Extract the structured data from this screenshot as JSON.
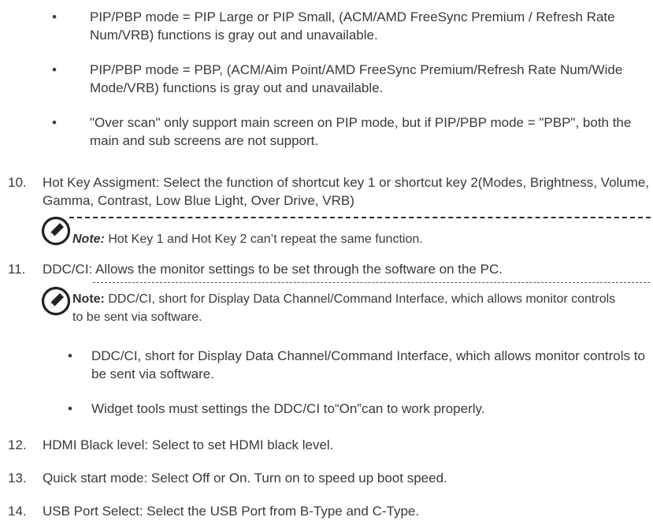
{
  "bullets_top": [
    "PIP/PBP mode = PIP Large or PIP Small, (ACM/AMD FreeSync Premium / Refresh Rate Num/VRB) functions is gray out and unavailable.",
    "PIP/PBP mode = PBP, (ACM/Aim Point/AMD FreeSync Premium/Refresh Rate Num/Wide Mode/VRB) functions is gray out and unavailable.",
    "\"Over scan\" only support main screen on PIP mode, but if PIP/PBP mode = \"PBP\", both the main and sub screens are not support."
  ],
  "bullet_char": "•",
  "item10": {
    "num": "10.",
    "text": "Hot Key Assigment: Select the function of shortcut key 1 or shortcut key 2(Modes, Brightness, Volume, Gamma, Contrast, Low Blue Light, Over Drive, VRB)",
    "note_label": "Note:",
    "note_text": " Hot Key 1 and Hot Key 2 can’t repeat the same function."
  },
  "item11": {
    "num": "11.",
    "text": "DDC/CI: Allows the monitor settings to be set through the software on the PC.",
    "note_label": "Note:",
    "note_text": " DDC/CI, short for Display Data Channel/Command Interface, which allows monitor controls to be sent via software.",
    "bullets": [
      "DDC/CI, short for Display Data Channel/Command Interface, which allows monitor controls to be sent via software.",
      "Widget tools must settings the DDC/CI to“On”can to work properly."
    ]
  },
  "item12": {
    "num": "12.",
    "text": "HDMI Black level: Select to set HDMI black level."
  },
  "item13": {
    "num": "13.",
    "text": "Quick start mode: Select Off or On. Turn on to speed up boot speed."
  },
  "item14": {
    "num": "14.",
    "text": "USB Port Select: Select the USB Port from B-Type and C-Type."
  },
  "icons": {
    "note": "note-pencil-icon"
  }
}
